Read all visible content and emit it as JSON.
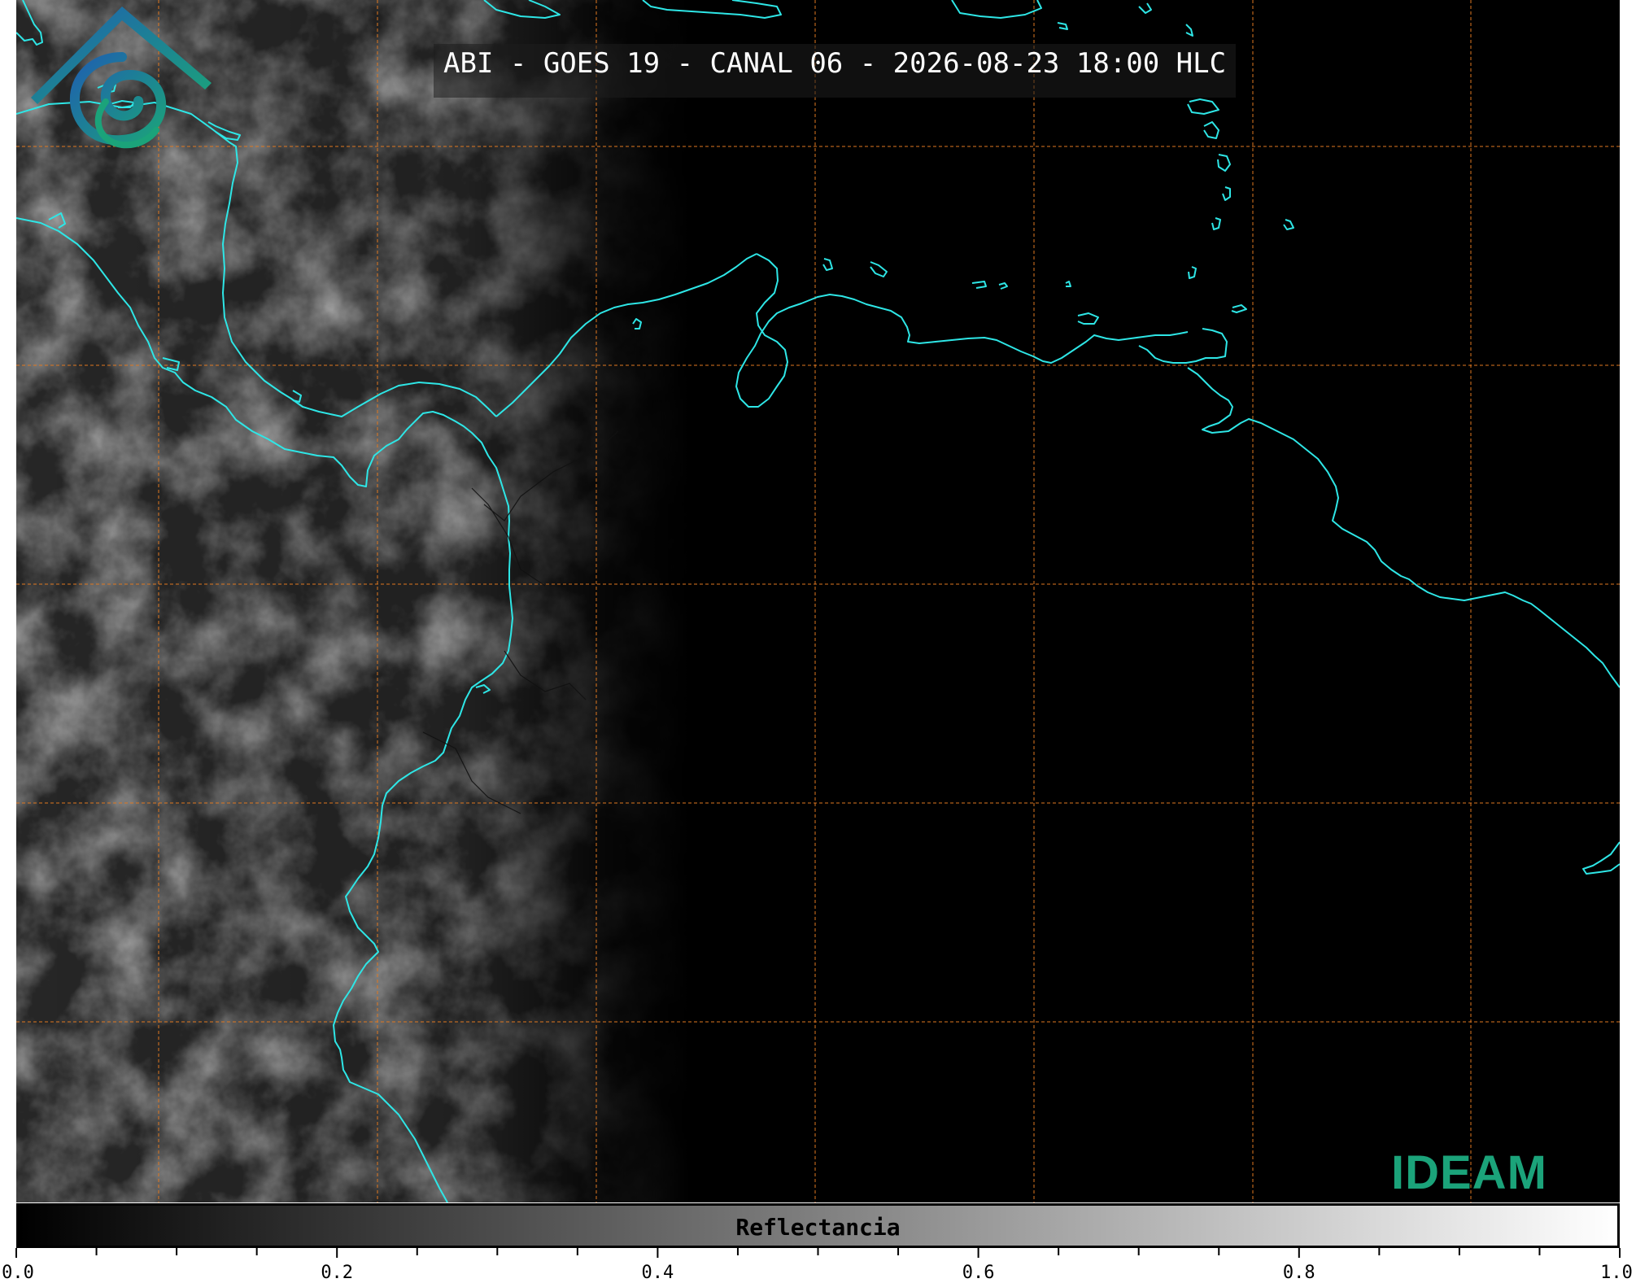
{
  "title": "ABI - GOES 19 - CANAL 06 - 2026-08-23 18:00 HLC",
  "logo": {
    "text": "IDEAM"
  },
  "colorbar": {
    "label": "Reflectancia",
    "range": [
      0.0,
      1.0
    ],
    "colors": [
      "#000000",
      "#ffffff"
    ],
    "tick_labels": [
      "0.0",
      "0.2",
      "0.4",
      "0.6",
      "0.8",
      "1.0"
    ]
  },
  "colors": {
    "coastline": "#2ee6e6",
    "gridline": "#e07820",
    "background": "#000000",
    "logo": "#1ba37a"
  }
}
